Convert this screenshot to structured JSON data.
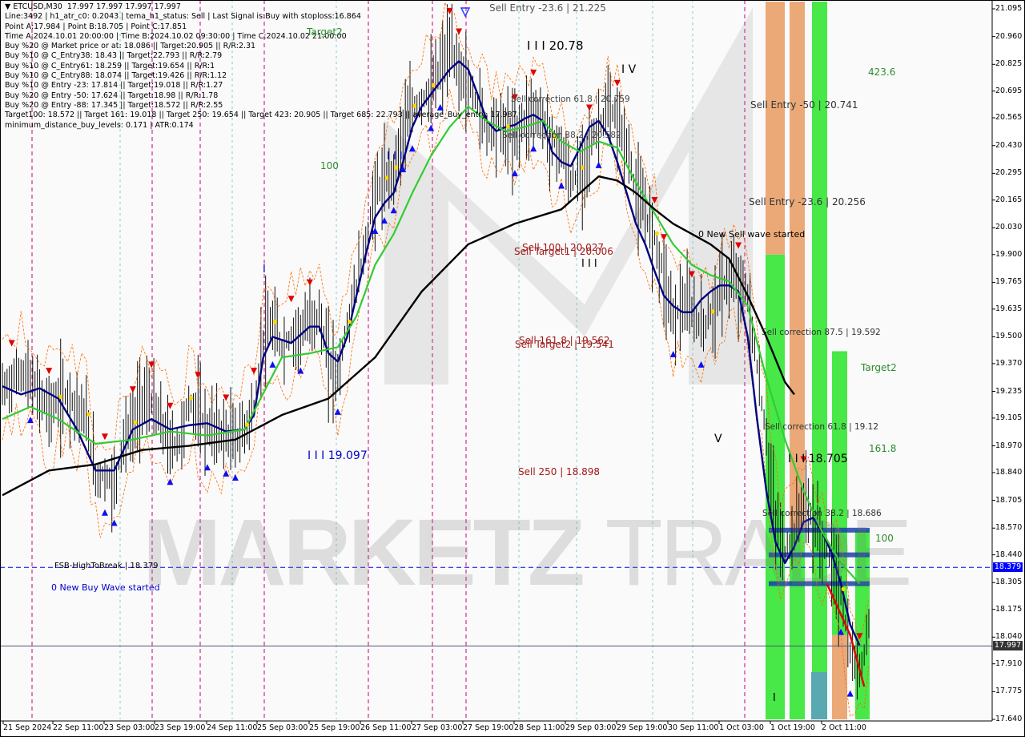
{
  "window": {
    "symbol": "ETCUSD,M30",
    "ohlc": "17.997 17.997 17.997 17.997"
  },
  "info_lines": [
    "Line:3492 | h1_atr_c0: 0.2043 | tema_h1_status: Sell | Last Signal is:Buy with stoploss:16.864",
    "Point A:17.984 | Point B:18.705 | Point C:17.851",
    "Time A:2024.10.01 20:00:00 | Time B:2024.10.02 09:30:00 | Time C:2024.10.02 21:00:00",
    "Buy %20 @ Market price or at: 18.086 || Target:20.905 || R/R:2.31",
    "Buy %10 @ C_Entry38: 18.43 || Target:22.793 || R/R:2.79",
    "Buy %10 @ C_Entry61: 18.259 || Target:19.654 || R/R:1",
    "Buy %10 @ C_Entry88: 18.074 || Target:19.426 || R/R:1.12",
    "Buy %10 @ Entry -23: 17.814 || Target:19.018 || R/R:1.27",
    "Buy %20 @ Entry -50: 17.624 || Target:18.98 || R/R:1.78",
    "Buy %20 @ Entry -88: 17.345 || Target:18.572 || R/R:2.55",
    "Target100: 18.572 || Target 161: 19.018 || Target 250: 19.654 || Target 423: 20.905 || Target 685: 22.793 || average_Buy_entry: 17.987",
    "minimum_distance_buy_levels: 0.171 | ATR:0.174"
  ],
  "annotations": {
    "sell_entry_top": "Sell Entry -23.6 | 21.225",
    "wave3_top": "I I I 20.78",
    "wave4": "I V",
    "target2_top": "Target2",
    "fib100_left": "100",
    "wave_i3": "I I I",
    "wave_i1": "I",
    "sell_corr_61_top": "Sell correction 61.8 | 20.759",
    "sell_corr_38": "Sell correction 38.2 | 20.582",
    "sell_100": "Sell 100 | 20.027",
    "sell_target1": "Sell Target1 | 20.006",
    "wave_iii_mid": "I I I",
    "new_sell_wave": "0 New Sell wave started",
    "sell_161": "Sell 161.8 | 19.562",
    "sell_target2": "Sell Target2 | 19.541",
    "wave3_low": "I I I 19.097",
    "sell_250": "Sell  250 | 18.898",
    "wave_v": "V",
    "fsb": "FSB-HighToBreak  | 18.379",
    "new_buy_wave": "0 New Buy Wave started",
    "fib423": "423.6",
    "sell_entry_50": "Sell Entry -50 | 20.741",
    "sell_entry_23": "Sell Entry -23.6 | 20.256",
    "sell_corr_87": "Sell correction 87.5 | 19.592",
    "target2_right": "Target2",
    "sell_corr_61_low": "Sell correction 61.8 | 19.12",
    "fib161": "161.8",
    "wave3_right": "I I I 18.705",
    "sell_corr_38_low": "Sell correction 38.2 | 18.686",
    "fib100_right": "100",
    "wave_i_bottom": "I"
  },
  "watermark": {
    "part1": "MARKETZ",
    "part2": "TRADE"
  },
  "price_tags": {
    "fsb": "18.379",
    "current": "17.997"
  },
  "colors": {
    "price_tag_blue": "#0000ff",
    "price_tag_dark": "#333333",
    "sma_black": "#000000",
    "ema_green": "#33cc33",
    "tema_navy": "#000080",
    "bar_lime": "#33e633",
    "bar_orange": "#e89a60",
    "bar_teal": "#5aa8b0",
    "bg_separator_magenta": "#cc0077"
  },
  "chart_data": {
    "type": "line",
    "ylim": [
      17.64,
      21.13
    ],
    "y_ticks": [
      "21.095",
      "20.960",
      "20.825",
      "20.695",
      "20.565",
      "20.430",
      "20.295",
      "20.165",
      "20.030",
      "19.900",
      "19.765",
      "19.635",
      "19.500",
      "19.370",
      "19.235",
      "19.105",
      "18.970",
      "18.840",
      "18.705",
      "18.570",
      "18.440",
      "18.305",
      "18.175",
      "18.040",
      "17.910",
      "17.775",
      "17.640"
    ],
    "x_ticks": [
      "21 Sep 2024",
      "22 Sep 11:00",
      "23 Sep 03:00",
      "23 Sep 19:00",
      "24 Sep 11:00",
      "25 Sep 03:00",
      "25 Sep 19:00",
      "26 Sep 11:00",
      "27 Sep 03:00",
      "27 Sep 19:00",
      "28 Sep 11:00",
      "29 Sep 03:00",
      "29 Sep 19:00",
      "30 Sep 11:00",
      "1 Oct 03:00",
      "1 Oct 19:00",
      "2 Oct 11:00"
    ],
    "series": [
      {
        "name": "",
        "role": "close",
        "color": "#000000",
        "values": [
          [
            0,
            19.24
          ],
          [
            2,
            19.33
          ],
          [
            3,
            19.28
          ],
          [
            5,
            19.15
          ],
          [
            7,
            19.22
          ],
          [
            9,
            19.1
          ],
          [
            10,
            18.82
          ],
          [
            11,
            18.83
          ],
          [
            12,
            18.78
          ],
          [
            13,
            19.0
          ],
          [
            14,
            19.06
          ],
          [
            15,
            19.2
          ],
          [
            16,
            19.18
          ],
          [
            18,
            18.98
          ],
          [
            19,
            18.98
          ],
          [
            20,
            19.18
          ],
          [
            21,
            19.13
          ],
          [
            22,
            19.05
          ],
          [
            23,
            19.05
          ],
          [
            24,
            19.02
          ],
          [
            25,
            19.0
          ],
          [
            26,
            19.05
          ],
          [
            27,
            19.15
          ],
          [
            28,
            19.5
          ],
          [
            29,
            19.55
          ],
          [
            30,
            19.45
          ],
          [
            31,
            19.5
          ],
          [
            32,
            19.52
          ],
          [
            33,
            19.58
          ],
          [
            34,
            19.6
          ],
          [
            35,
            19.38
          ],
          [
            36,
            19.32
          ],
          [
            37,
            19.55
          ],
          [
            38,
            19.75
          ],
          [
            39,
            19.95
          ],
          [
            40,
            20.2
          ],
          [
            41,
            20.25
          ],
          [
            42,
            20.3
          ],
          [
            43,
            20.5
          ],
          [
            44,
            20.6
          ],
          [
            45,
            20.65
          ],
          [
            46,
            20.7
          ],
          [
            47,
            20.8
          ],
          [
            48,
            20.9
          ],
          [
            49,
            20.8
          ],
          [
            50,
            20.72
          ],
          [
            51,
            20.64
          ],
          [
            52,
            20.5
          ],
          [
            53,
            20.55
          ],
          [
            54,
            20.5
          ],
          [
            55,
            20.48
          ],
          [
            56,
            20.55
          ],
          [
            57,
            20.6
          ],
          [
            58,
            20.55
          ],
          [
            59,
            20.45
          ],
          [
            60,
            20.42
          ],
          [
            61,
            20.25
          ],
          [
            62,
            20.3
          ],
          [
            63,
            20.43
          ],
          [
            64,
            20.52
          ],
          [
            65,
            20.6
          ],
          [
            66,
            20.55
          ],
          [
            67,
            20.43
          ],
          [
            68,
            20.2
          ],
          [
            69,
            20.1
          ],
          [
            70,
            19.98
          ],
          [
            71,
            19.8
          ],
          [
            72,
            19.6
          ],
          [
            73,
            19.65
          ],
          [
            74,
            19.62
          ],
          [
            75,
            19.55
          ],
          [
            76,
            19.6
          ],
          [
            77,
            19.72
          ],
          [
            78,
            19.78
          ],
          [
            79,
            19.76
          ],
          [
            80,
            19.7
          ],
          [
            81,
            19.35
          ],
          [
            82,
            19.0
          ],
          [
            83,
            18.6
          ],
          [
            84,
            18.45
          ],
          [
            85,
            18.55
          ],
          [
            86,
            18.72
          ],
          [
            87,
            18.6
          ],
          [
            88,
            18.5
          ],
          [
            89,
            18.42
          ],
          [
            90,
            18.25
          ],
          [
            91,
            17.95
          ],
          [
            92,
            17.86
          ],
          [
            93,
            18.1
          ]
        ]
      },
      {
        "name": "",
        "role": "tema",
        "color": "#000080",
        "values": [
          [
            0,
            19.26
          ],
          [
            2,
            19.22
          ],
          [
            4,
            19.25
          ],
          [
            6,
            19.2
          ],
          [
            8,
            19.05
          ],
          [
            10,
            18.85
          ],
          [
            12,
            18.85
          ],
          [
            14,
            19.05
          ],
          [
            16,
            19.1
          ],
          [
            18,
            19.05
          ],
          [
            20,
            19.07
          ],
          [
            22,
            19.08
          ],
          [
            24,
            19.04
          ],
          [
            26,
            19.05
          ],
          [
            27,
            19.12
          ],
          [
            28,
            19.4
          ],
          [
            29,
            19.5
          ],
          [
            31,
            19.47
          ],
          [
            33,
            19.55
          ],
          [
            34,
            19.55
          ],
          [
            35,
            19.42
          ],
          [
            36,
            19.38
          ],
          [
            37,
            19.5
          ],
          [
            38,
            19.7
          ],
          [
            39,
            19.9
          ],
          [
            40,
            20.08
          ],
          [
            41,
            20.15
          ],
          [
            42,
            20.2
          ],
          [
            43,
            20.35
          ],
          [
            44,
            20.52
          ],
          [
            45,
            20.62
          ],
          [
            46,
            20.68
          ],
          [
            47,
            20.74
          ],
          [
            48,
            20.8
          ],
          [
            49,
            20.84
          ],
          [
            50,
            20.8
          ],
          [
            51,
            20.68
          ],
          [
            52,
            20.55
          ],
          [
            53,
            20.5
          ],
          [
            54,
            20.52
          ],
          [
            55,
            20.53
          ],
          [
            56,
            20.56
          ],
          [
            57,
            20.58
          ],
          [
            58,
            20.55
          ],
          [
            59,
            20.4
          ],
          [
            60,
            20.35
          ],
          [
            61,
            20.33
          ],
          [
            62,
            20.42
          ],
          [
            63,
            20.52
          ],
          [
            64,
            20.55
          ],
          [
            65,
            20.48
          ],
          [
            66,
            20.35
          ],
          [
            67,
            20.2
          ],
          [
            68,
            20.05
          ],
          [
            69,
            19.95
          ],
          [
            70,
            19.82
          ],
          [
            71,
            19.7
          ],
          [
            72,
            19.65
          ],
          [
            73,
            19.62
          ],
          [
            74,
            19.62
          ],
          [
            75,
            19.68
          ],
          [
            76,
            19.72
          ],
          [
            77,
            19.75
          ],
          [
            78,
            19.75
          ],
          [
            79,
            19.72
          ],
          [
            80,
            19.5
          ],
          [
            81,
            19.1
          ],
          [
            82,
            18.75
          ],
          [
            83,
            18.5
          ],
          [
            84,
            18.4
          ],
          [
            85,
            18.48
          ],
          [
            86,
            18.6
          ],
          [
            87,
            18.62
          ],
          [
            88,
            18.55
          ],
          [
            89,
            18.45
          ],
          [
            90,
            18.3
          ],
          [
            91,
            18.1
          ],
          [
            92,
            18.0
          ]
        ]
      },
      {
        "name": "",
        "role": "ema",
        "color": "#33cc33",
        "values": [
          [
            0,
            19.1
          ],
          [
            3,
            19.16
          ],
          [
            6,
            19.1
          ],
          [
            10,
            18.98
          ],
          [
            14,
            19.0
          ],
          [
            18,
            19.04
          ],
          [
            22,
            19.02
          ],
          [
            26,
            19.05
          ],
          [
            30,
            19.4
          ],
          [
            33,
            19.42
          ],
          [
            36,
            19.45
          ],
          [
            38,
            19.6
          ],
          [
            40,
            19.85
          ],
          [
            42,
            20.0
          ],
          [
            44,
            20.2
          ],
          [
            46,
            20.38
          ],
          [
            48,
            20.52
          ],
          [
            50,
            20.62
          ],
          [
            52,
            20.55
          ],
          [
            54,
            20.5
          ],
          [
            56,
            20.52
          ],
          [
            58,
            20.55
          ],
          [
            60,
            20.45
          ],
          [
            62,
            20.4
          ],
          [
            64,
            20.45
          ],
          [
            66,
            20.42
          ],
          [
            68,
            20.25
          ],
          [
            70,
            20.1
          ],
          [
            72,
            19.95
          ],
          [
            74,
            19.85
          ],
          [
            76,
            19.8
          ],
          [
            78,
            19.77
          ],
          [
            80,
            19.65
          ],
          [
            82,
            19.3
          ],
          [
            84,
            19.0
          ],
          [
            86,
            18.75
          ],
          [
            88,
            18.55
          ],
          [
            90,
            18.4
          ],
          [
            92,
            18.3
          ]
        ]
      },
      {
        "name": "",
        "role": "sma",
        "color": "#000000",
        "values": [
          [
            0,
            18.73
          ],
          [
            5,
            18.85
          ],
          [
            10,
            18.88
          ],
          [
            15,
            18.95
          ],
          [
            20,
            18.97
          ],
          [
            25,
            19.0
          ],
          [
            30,
            19.12
          ],
          [
            35,
            19.2
          ],
          [
            40,
            19.4
          ],
          [
            45,
            19.72
          ],
          [
            50,
            19.95
          ],
          [
            55,
            20.05
          ],
          [
            60,
            20.12
          ],
          [
            62,
            20.2
          ],
          [
            64,
            20.28
          ],
          [
            66,
            20.26
          ],
          [
            68,
            20.2
          ],
          [
            70,
            20.12
          ],
          [
            72,
            20.05
          ],
          [
            74,
            20.0
          ],
          [
            76,
            19.95
          ],
          [
            78,
            19.88
          ],
          [
            80,
            19.7
          ],
          [
            82,
            19.5
          ],
          [
            84,
            19.28
          ],
          [
            85,
            19.22
          ]
        ]
      }
    ],
    "signal_bars": [
      {
        "color": "lime",
        "from": 17.64,
        "to": 19.9
      },
      {
        "color": "orange",
        "from": 19.9,
        "to": 21.13
      },
      {
        "color": "lime",
        "from": 17.64,
        "to": 18.55
      },
      {
        "color": "orange",
        "from": 18.55,
        "to": 21.13
      },
      {
        "color": "lime",
        "from": 17.64,
        "to": 21.13
      },
      {
        "color": "teal",
        "from": 17.64,
        "to": 17.87
      },
      {
        "color": "lime",
        "from": 18.05,
        "to": 19.43
      },
      {
        "color": "orange",
        "from": 17.64,
        "to": 18.05
      },
      {
        "color": "lime",
        "from": 17.64,
        "to": 18.56
      }
    ],
    "horizontal_levels": [
      {
        "name": "FSB-HighToBreak",
        "value": 18.379,
        "style": "dashed",
        "color": "#0000ff"
      },
      {
        "name": "current",
        "value": 17.997,
        "style": "solid",
        "color": "#555577"
      }
    ]
  }
}
